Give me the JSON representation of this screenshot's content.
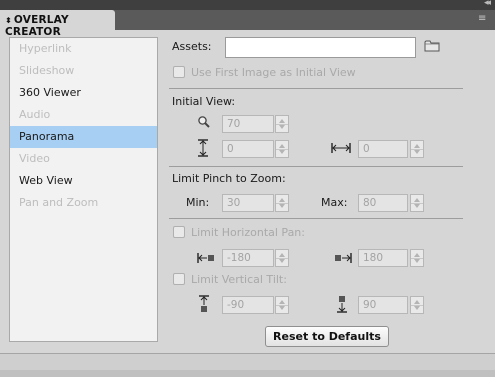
{
  "panel": {
    "title": "OVERLAY CREATOR"
  },
  "sidebar": {
    "items": [
      {
        "label": "Hyperlink",
        "state": "disabled"
      },
      {
        "label": "Slideshow",
        "state": "disabled"
      },
      {
        "label": "360 Viewer",
        "state": "enabled"
      },
      {
        "label": "Audio",
        "state": "disabled"
      },
      {
        "label": "Panorama",
        "state": "selected"
      },
      {
        "label": "Video",
        "state": "disabled"
      },
      {
        "label": "Web View",
        "state": "enabled"
      },
      {
        "label": "Pan and Zoom",
        "state": "disabled"
      }
    ]
  },
  "assets": {
    "label": "Assets:",
    "value": "",
    "first_image_label": "Use First Image as Initial View",
    "first_image_checked": false
  },
  "initial_view": {
    "label": "Initial View:",
    "zoom": "70",
    "tilt": "0",
    "pan": "0"
  },
  "pinch_zoom": {
    "label": "Limit Pinch to Zoom:",
    "min_label": "Min:",
    "min": "30",
    "max_label": "Max:",
    "max": "80"
  },
  "horizontal_pan": {
    "label": "Limit Horizontal Pan:",
    "checked": false,
    "left": "-180",
    "right": "180"
  },
  "vertical_tilt": {
    "label": "Limit Vertical Tilt:",
    "checked": false,
    "down": "-90",
    "up": "90"
  },
  "reset_button": {
    "label": "Reset to Defaults"
  },
  "colors": {
    "selection": "#a7cff3",
    "panel_bg": "#d6d6d6",
    "title_bar": "#3f3f3f",
    "tab_strip": "#5a5a5a"
  }
}
